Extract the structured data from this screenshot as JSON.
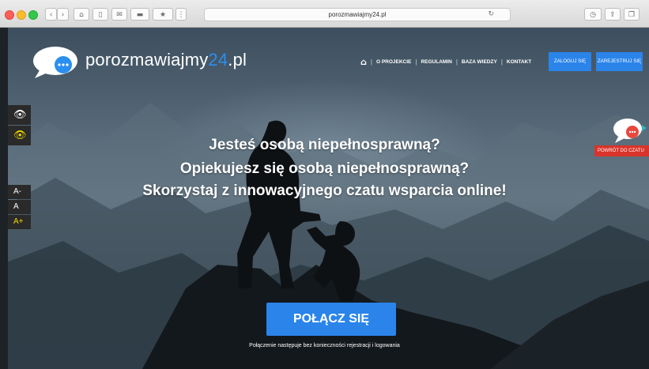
{
  "browser": {
    "url": "porozmawiajmy24.pl",
    "reload_icon": "reload-icon",
    "icons": [
      "back-icon",
      "forward-icon",
      "home-icon",
      "sidebar-icon",
      "mail-icon",
      "print-icon",
      "bookmark-icon",
      "grid-icon",
      "download-icon",
      "share-icon",
      "tabs-icon"
    ]
  },
  "header": {
    "logo_main": "porozmawiajmy",
    "logo_accent": "24",
    "logo_suffix": ".pl",
    "logo_icon": "speech-bubble-logo",
    "nav": {
      "home_icon": "home-icon",
      "items": [
        "O PROJEKCIE",
        "REGULAMIN",
        "BAZA WIEDZY",
        "KONTAKT"
      ]
    },
    "login_label": "ZALOGUJ SIĘ",
    "register_label": "ZAREJESTRUJ SIĘ"
  },
  "accessibility": {
    "eye_icon": "eye-icon",
    "contrast_icon": "contrast-eye-icon",
    "font_decrease": "A-",
    "font_normal": "A",
    "font_increase": "A+"
  },
  "hero": {
    "line1": "Jesteś osobą niepełnosprawną?",
    "line2": "Opiekujesz się osobą niepełnosprawną?",
    "line3": "Skorzystaj z innowacyjnego czatu wsparcia online!",
    "cta_label": "POŁĄCZ SIĘ",
    "note": "Połączenie następuje bez konieczności rejestracji i logowania"
  },
  "chat_widget": {
    "icon": "chat-bubble-icon",
    "return_label": "POWRÓT DO CZATU"
  },
  "colors": {
    "accent": "#2a84ea",
    "logo_accent": "#2b8ff0",
    "chat_return": "#d9342b",
    "contrast_yellow": "#f3d800"
  }
}
